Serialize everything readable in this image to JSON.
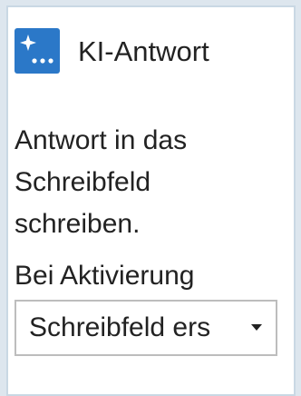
{
  "header": {
    "title": "KI-Antwort",
    "icon": "ai-sparkle-icon"
  },
  "description": {
    "line1": "Antwort in das",
    "line2": "Schreibfeld",
    "line3": "schreiben."
  },
  "activation": {
    "label": "Bei Aktivierung",
    "selected_value": "Schreibfeld ers",
    "dropdown_icon": "chevron-down-icon"
  },
  "colors": {
    "icon_background": "#2b78c8",
    "panel_border": "#c9d8e4",
    "text": "#222222"
  }
}
